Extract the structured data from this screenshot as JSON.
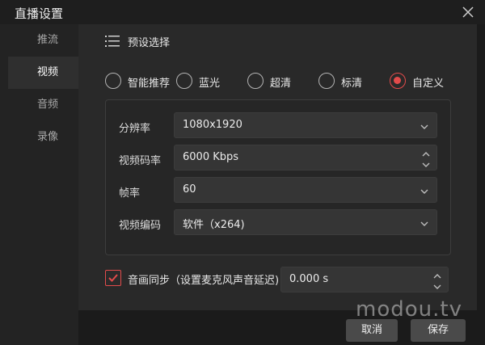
{
  "window": {
    "title": "直播设置",
    "close_icon": "close-icon"
  },
  "sidebar": {
    "items": [
      {
        "label": "推流",
        "active": false
      },
      {
        "label": "视频",
        "active": true
      },
      {
        "label": "音频",
        "active": false
      },
      {
        "label": "录像",
        "active": false
      }
    ]
  },
  "preset": {
    "title": "预设选择",
    "icon": "list-icon",
    "options": [
      {
        "label": "智能推荐",
        "checked": false
      },
      {
        "label": "蓝光",
        "checked": false
      },
      {
        "label": "超清",
        "checked": false
      },
      {
        "label": "标清",
        "checked": false
      },
      {
        "label": "自定义",
        "checked": true
      }
    ]
  },
  "settings": {
    "resolution": {
      "label": "分辨率",
      "value": "1080x1920"
    },
    "bitrate": {
      "label": "视频码率",
      "value": "6000 Kbps"
    },
    "framerate": {
      "label": "帧率",
      "value": "60"
    },
    "encoder": {
      "label": "视频编码",
      "value": "软件（x264)"
    }
  },
  "sync": {
    "label": "音画同步（设置麦克风声音延迟)",
    "checked": true,
    "delay_value": "0.000 s"
  },
  "watermark": "modou.tv",
  "footer": {
    "cancel_label": "取消",
    "save_label": "保存"
  },
  "colors": {
    "accent": "#e24b4b",
    "background": "#1b1b1b",
    "panel": "#292929"
  }
}
